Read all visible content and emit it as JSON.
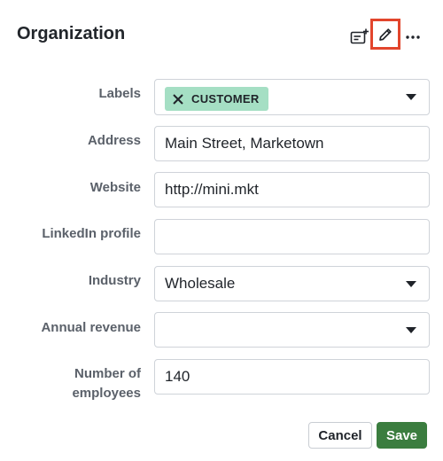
{
  "header": {
    "title": "Organization"
  },
  "icons": {
    "add_card": "add-card-icon",
    "edit": "pencil-icon",
    "more": "more-horizontal-icon",
    "tag_remove": "close-icon",
    "dropdown": "chevron-down-icon"
  },
  "colors": {
    "tag_bg": "#a5dfc4",
    "save_bg": "#3b7d3f",
    "highlight": "#e2452c"
  },
  "form": {
    "labels": {
      "label": "Labels",
      "tag": "CUSTOMER"
    },
    "address": {
      "label": "Address",
      "value": "Main Street, Marketown"
    },
    "website": {
      "label": "Website",
      "value": "http://mini.mkt"
    },
    "linkedin": {
      "label": "LinkedIn profile",
      "value": ""
    },
    "industry": {
      "label": "Industry",
      "value": "Wholesale"
    },
    "annual_revenue": {
      "label": "Annual revenue",
      "value": ""
    },
    "employees": {
      "label_line1": "Number of",
      "label_line2": "employees",
      "value": "140"
    }
  },
  "actions": {
    "cancel": "Cancel",
    "save": "Save"
  }
}
